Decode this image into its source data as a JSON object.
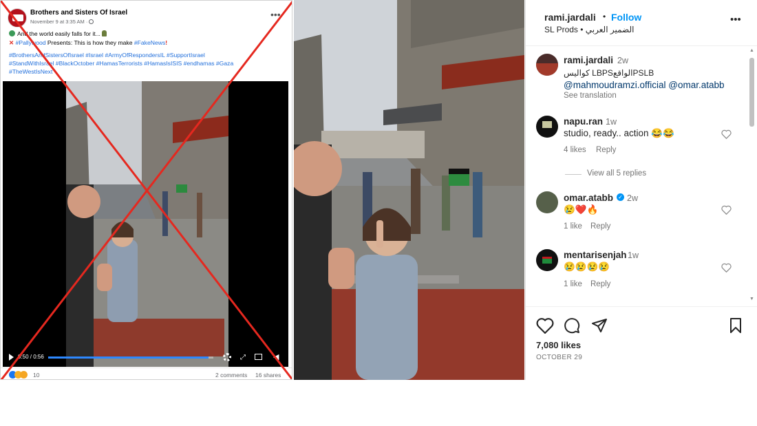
{
  "facebook_post": {
    "page_name": "Brothers and Sisters Of Israel",
    "timestamp": "November 9 at 3:35 AM · ",
    "caption_line1": "And the world easily falls for it... ",
    "caption_line2_part1": "#Pallywood",
    "caption_line2_part2": " Presents: This is how they make ",
    "caption_line2_part3": "#FakeNews",
    "hashtags_line1": "#BrothersAndSistersOfIsrael #Israel #ArmyOfRespondersIL #SupportIsrael",
    "hashtags_line2": "#StandWithIsrael #BlackOctober #HamasTerrorists #HamasIsISIS #endhamas  #Gaza",
    "hashtags_line3": "#TheWestIsNext",
    "video_time": "0:50 / 0:56",
    "video_progress": 0.97,
    "reaction_count": "10",
    "comments": "2 comments",
    "shares": "16 shares",
    "more_icon": "more-horizontal-icon"
  },
  "instagram_post": {
    "username": "rami.jardali",
    "follow_label": "Follow",
    "separator": "•",
    "location_line": "SL Prods • الضمير العربي",
    "more_icon": "more-horizontal-icon",
    "caption": {
      "user": "rami.jardali",
      "time": "2w",
      "text": "كواليس LBPSالواقعPSLB",
      "mentions": "@mahmoudramzi.official @omar.atabb",
      "see_translation": "See translation"
    },
    "comments": [
      {
        "user": "napu.ran",
        "time": "1w",
        "text": "studio, ready.. action 😂😂",
        "likes": "4 likes",
        "reply": "Reply",
        "view_replies": "View all 5 replies"
      },
      {
        "user": "omar.atabb",
        "time": "2w",
        "verified": true,
        "text": "😢❤️🔥",
        "likes": "1 like",
        "reply": "Reply"
      },
      {
        "user": "mentarisenjah",
        "time": "1w",
        "text": "😢😢😢😢",
        "likes": "1 like",
        "reply": "Reply"
      }
    ],
    "likes_count": "7,080 likes",
    "date": "OCTOBER 29",
    "accent_color": "#0095f6"
  }
}
